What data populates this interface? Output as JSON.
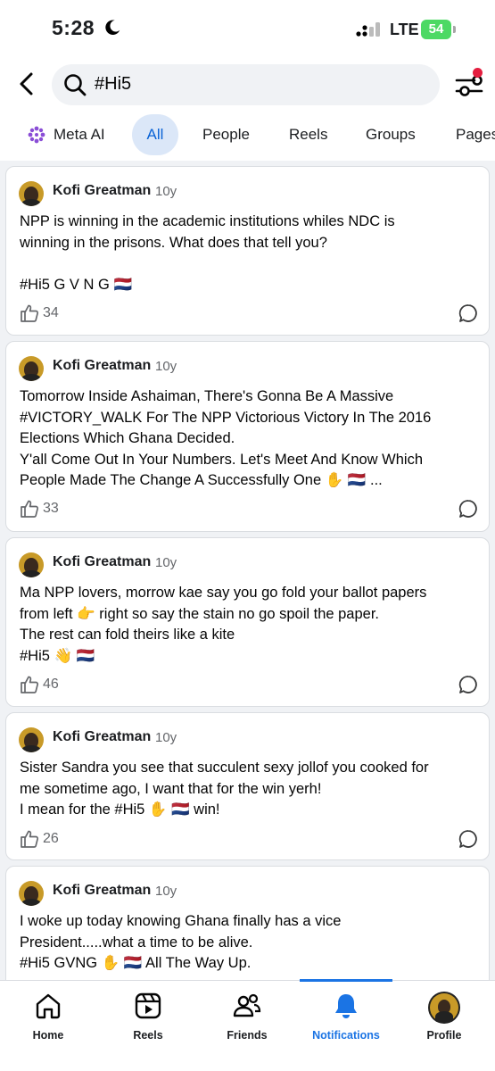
{
  "status_bar": {
    "time": "5:28",
    "network": "LTE",
    "battery": "54"
  },
  "search": {
    "query": "#Hi5"
  },
  "tabs": [
    {
      "label": "Meta AI"
    },
    {
      "label": "All",
      "selected": true
    },
    {
      "label": "People"
    },
    {
      "label": "Reels"
    },
    {
      "label": "Groups"
    },
    {
      "label": "Pages"
    }
  ],
  "posts": [
    {
      "author": "Kofi Greatman",
      "time": "10y",
      "text": "NPP is winning in the academic institutions whiles NDC is\nwinning in the prisons. What does that tell you?\n\n#Hi5  G V N G 🇳🇱",
      "likes": "34"
    },
    {
      "author": "Kofi Greatman",
      "time": "10y",
      "text": "Tomorrow Inside Ashaiman, There's Gonna Be A Massive\n#VICTORY_WALK For The NPP Victorious Victory In The 2016\nElections Which Ghana Decided.\nY'all Come Out In Your Numbers. Let's Meet And Know Which\nPeople Made The Change A Successfully One ✋ 🇳🇱 ...",
      "likes": "33"
    },
    {
      "author": "Kofi Greatman",
      "time": "10y",
      "text": "Ma NPP lovers, morrow kae say you go fold your ballot papers\nfrom left 👉 right so say the stain no go spoil the paper.\nThe rest can fold theirs like a kite\n#Hi5 👋 🇳🇱",
      "likes": "46"
    },
    {
      "author": "Kofi Greatman",
      "time": "10y",
      "text": "Sister Sandra you see that succulent sexy jollof you cooked for\nme sometime ago, I want that for the win yerh!\nI mean for the #Hi5 ✋ 🇳🇱 win!",
      "likes": "26"
    },
    {
      "author": "Kofi Greatman",
      "time": "10y",
      "text": "I woke up today knowing Ghana finally has a vice\nPresident.....what a time to be alive.\n#Hi5 GVNG ✋ 🇳🇱  All The Way Up.",
      "likes": ""
    }
  ],
  "bottom_nav": [
    {
      "label": "Home",
      "icon": "home-icon"
    },
    {
      "label": "Reels",
      "icon": "reels-icon"
    },
    {
      "label": "Friends",
      "icon": "friends-icon"
    },
    {
      "label": "Notifications",
      "icon": "bell-icon",
      "active": true
    },
    {
      "label": "Profile",
      "icon": "avatar"
    }
  ],
  "colors": {
    "accent": "#1b74e4",
    "selected_tab_bg": "#dbe7f8",
    "notification_dot": "#e41e3f",
    "battery": "#4cd964"
  }
}
